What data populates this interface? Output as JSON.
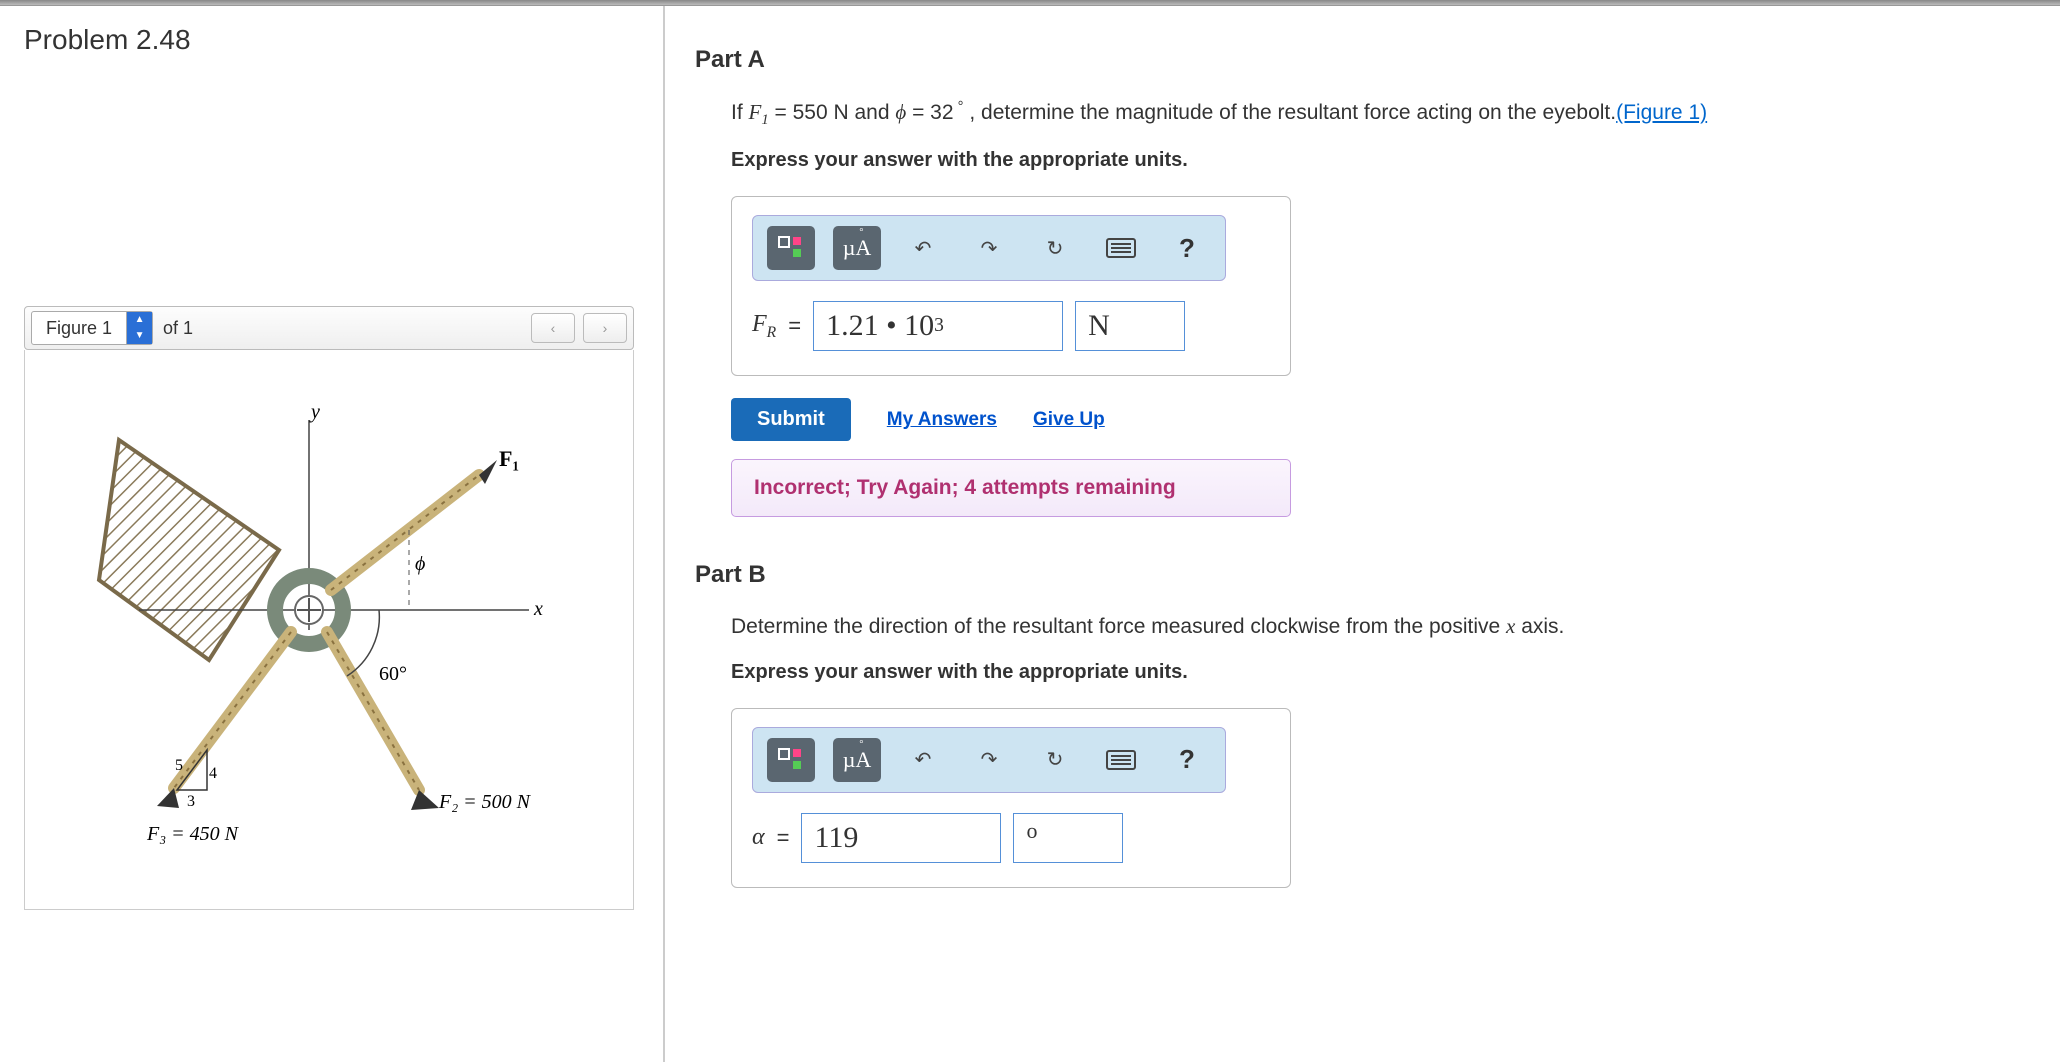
{
  "problem_title": "Problem 2.48",
  "figure_bar": {
    "label": "Figure 1",
    "of_text": "of 1"
  },
  "figure": {
    "y_label": "y",
    "x_label": "x",
    "f1_label": "F₁",
    "phi_label": "ϕ",
    "angle60": "60°",
    "slope_rise": "5",
    "slope_run": "4",
    "slope_hyp": "3",
    "f2_label": "F₂ = 500 N",
    "f3_label": "F₃ = 450 N"
  },
  "partA": {
    "label": "Part A",
    "prompt_prefix": "If ",
    "f1_eq": " = 550 N and ",
    "phi_eq": " = 32",
    "prompt_suffix": " , determine the magnitude of the resultant force acting on the eyebolt.",
    "fig_link": "(Figure 1)",
    "units_instr": "Express your answer with the appropriate units.",
    "toolbar_units": "µÅ",
    "var": "F",
    "var_sub": "R",
    "equals": "=",
    "value": "1.21 • 10",
    "value_sup": "3",
    "unit": "N",
    "submit": "Submit",
    "my_answers": "My Answers",
    "give_up": "Give Up",
    "feedback": "Incorrect; Try Again; 4 attempts remaining"
  },
  "partB": {
    "label": "Part B",
    "prompt": "Determine the direction of the resultant force measured clockwise from the positive ",
    "prompt_var": "x",
    "prompt_end": " axis.",
    "units_instr": "Express your answer with the appropriate units.",
    "toolbar_units": "µÅ",
    "var": "α",
    "equals": "=",
    "value": "119",
    "unit": "o"
  }
}
